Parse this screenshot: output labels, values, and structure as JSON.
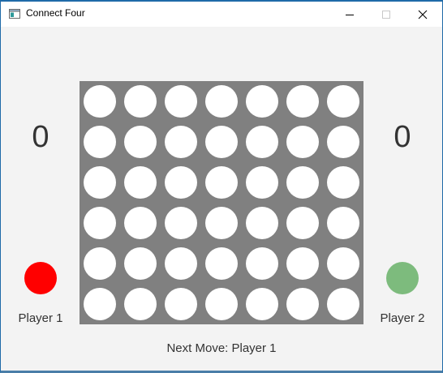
{
  "window": {
    "title": "Connect Four",
    "app_icon": "window-app-icon",
    "controls": [
      "minimize-icon",
      "maximize-icon",
      "close-icon"
    ]
  },
  "players": [
    {
      "label": "Player 1",
      "score": "0",
      "color": "#ff0000"
    },
    {
      "label": "Player 2",
      "score": "0",
      "color": "#7dbb7d"
    }
  ],
  "board": {
    "rows": 6,
    "columns": 7,
    "background_color": "#808080",
    "empty_color": "#ffffff",
    "cells": [
      [
        "empty",
        "empty",
        "empty",
        "empty",
        "empty",
        "empty",
        "empty"
      ],
      [
        "empty",
        "empty",
        "empty",
        "empty",
        "empty",
        "empty",
        "empty"
      ],
      [
        "empty",
        "empty",
        "empty",
        "empty",
        "empty",
        "empty",
        "empty"
      ],
      [
        "empty",
        "empty",
        "empty",
        "empty",
        "empty",
        "empty",
        "empty"
      ],
      [
        "empty",
        "empty",
        "empty",
        "empty",
        "empty",
        "empty",
        "empty"
      ],
      [
        "empty",
        "empty",
        "empty",
        "empty",
        "empty",
        "empty",
        "empty"
      ]
    ]
  },
  "status": {
    "text": "Next Move: Player 1"
  }
}
